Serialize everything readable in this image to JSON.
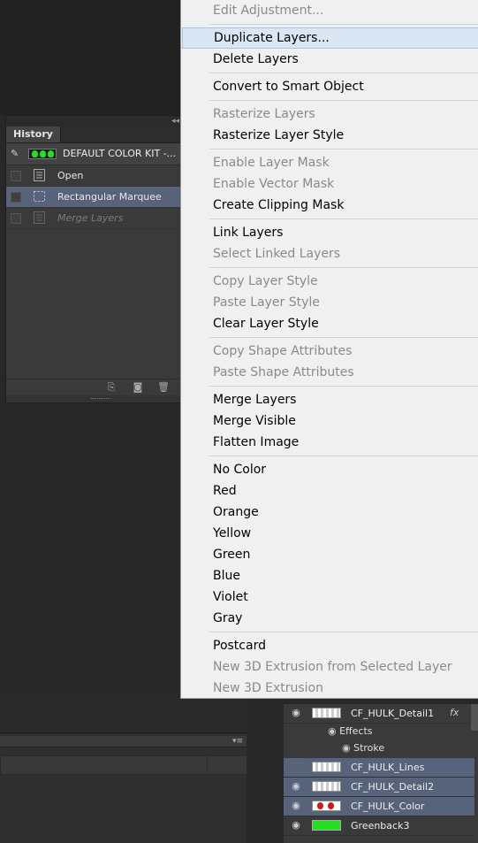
{
  "history_panel": {
    "tab_label": "History",
    "collapse_glyph": "◂◂",
    "snapshot_name": "DEFAULT COLOR KIT -...",
    "steps": [
      {
        "label": "Open",
        "icon": "document-icon"
      },
      {
        "label": "Rectangular Marquee",
        "icon": "marquee-icon"
      },
      {
        "label": "Merge Layers",
        "icon": "document-icon"
      }
    ],
    "footer_icons": [
      "new-document-from-state-icon",
      "camera-snapshot-icon",
      "trash-icon"
    ]
  },
  "context_menu": {
    "groups": [
      [
        {
          "label": "Edit Adjustment...",
          "enabled": false
        }
      ],
      [
        {
          "label": "Duplicate Layers...",
          "enabled": true,
          "highlighted": true
        },
        {
          "label": "Delete Layers",
          "enabled": true
        }
      ],
      [
        {
          "label": "Convert to Smart Object",
          "enabled": true
        }
      ],
      [
        {
          "label": "Rasterize Layers",
          "enabled": false
        },
        {
          "label": "Rasterize Layer Style",
          "enabled": true
        }
      ],
      [
        {
          "label": "Enable Layer Mask",
          "enabled": false
        },
        {
          "label": "Enable Vector Mask",
          "enabled": false
        },
        {
          "label": "Create Clipping Mask",
          "enabled": true
        }
      ],
      [
        {
          "label": "Link Layers",
          "enabled": true
        },
        {
          "label": "Select Linked Layers",
          "enabled": false
        }
      ],
      [
        {
          "label": "Copy Layer Style",
          "enabled": false
        },
        {
          "label": "Paste Layer Style",
          "enabled": false
        },
        {
          "label": "Clear Layer Style",
          "enabled": true
        }
      ],
      [
        {
          "label": "Copy Shape Attributes",
          "enabled": false
        },
        {
          "label": "Paste Shape Attributes",
          "enabled": false
        }
      ],
      [
        {
          "label": "Merge Layers",
          "enabled": true
        },
        {
          "label": "Merge Visible",
          "enabled": true
        },
        {
          "label": "Flatten Image",
          "enabled": true
        }
      ],
      [
        {
          "label": "No Color",
          "enabled": true
        },
        {
          "label": "Red",
          "enabled": true
        },
        {
          "label": "Orange",
          "enabled": true
        },
        {
          "label": "Yellow",
          "enabled": true
        },
        {
          "label": "Green",
          "enabled": true
        },
        {
          "label": "Blue",
          "enabled": true
        },
        {
          "label": "Violet",
          "enabled": true
        },
        {
          "label": "Gray",
          "enabled": true
        }
      ],
      [
        {
          "label": "Postcard",
          "enabled": true
        },
        {
          "label": "New 3D Extrusion from Selected Layer",
          "enabled": false
        },
        {
          "label": "New 3D Extrusion",
          "enabled": false
        }
      ]
    ]
  },
  "layers_panel": {
    "layers": [
      {
        "name": "CF_HULK_Detail1",
        "visible": true,
        "selected": false,
        "thumb": "transparent",
        "fx": "fx"
      },
      {
        "name": "CF_HULK_Lines",
        "visible": false,
        "selected": true,
        "thumb": "transparent"
      },
      {
        "name": "CF_HULK_Detail2",
        "visible": true,
        "selected": true,
        "thumb": "transparent"
      },
      {
        "name": "CF_HULK_Color",
        "visible": true,
        "selected": true,
        "thumb": "color"
      },
      {
        "name": "Greenback3",
        "visible": true,
        "selected": false,
        "thumb": "green"
      }
    ],
    "effects_label": "Effects",
    "stroke_label": "Stroke"
  },
  "colors": {
    "selection": "#56637a",
    "menu_bg": "#f0f0f0",
    "menu_highlight": "#dbe6f4",
    "disabled_text": "#8a8a8a"
  }
}
